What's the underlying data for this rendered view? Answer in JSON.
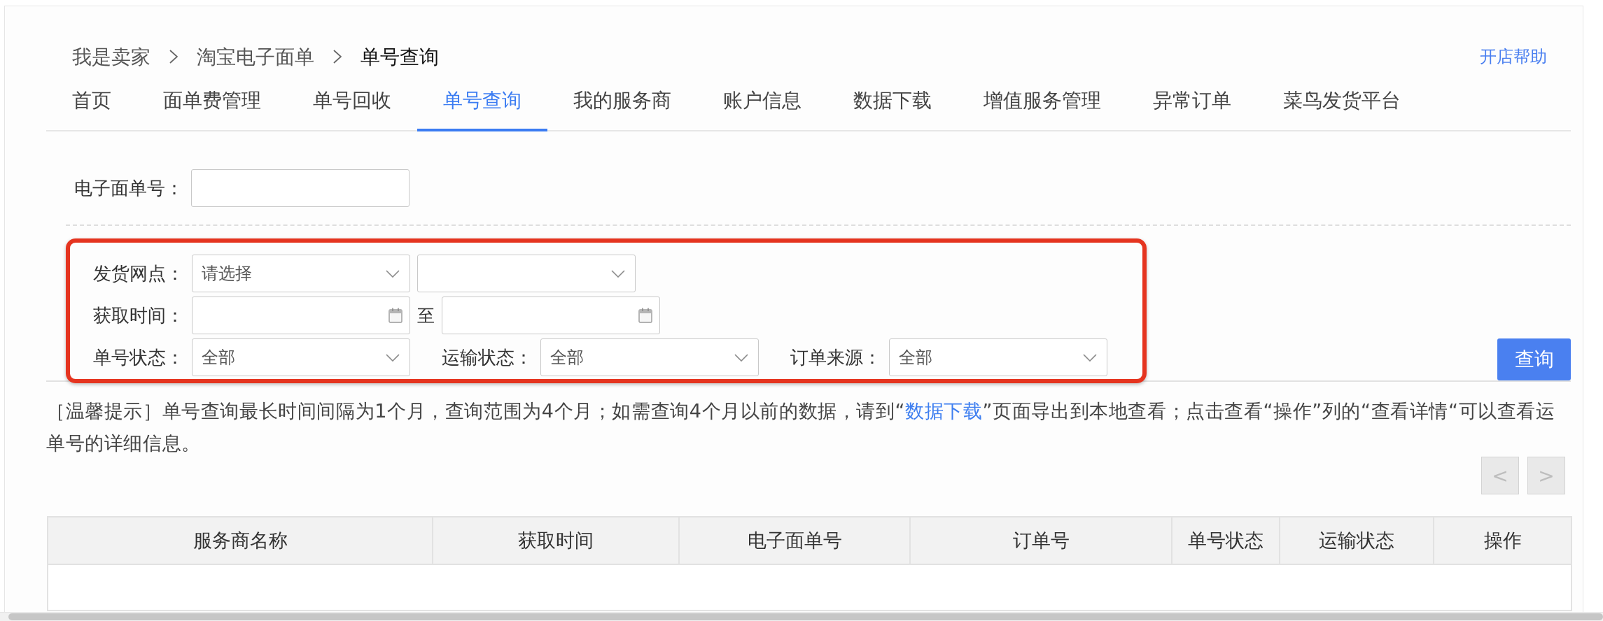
{
  "breadcrumb": [
    {
      "label": "我是卖家",
      "current": false
    },
    {
      "label": "淘宝电子面单",
      "current": false
    },
    {
      "label": "单号查询",
      "current": true
    }
  ],
  "help_link": "开店帮助",
  "tabs": [
    {
      "label": "首页",
      "selected": false
    },
    {
      "label": "面单费管理",
      "selected": false
    },
    {
      "label": "单号回收",
      "selected": false
    },
    {
      "label": "单号查询",
      "selected": true
    },
    {
      "label": "我的服务商",
      "selected": false
    },
    {
      "label": "账户信息",
      "selected": false
    },
    {
      "label": "数据下载",
      "selected": false
    },
    {
      "label": "增值服务管理",
      "selected": false
    },
    {
      "label": "异常订单",
      "selected": false
    },
    {
      "label": "菜鸟发货平台",
      "selected": false
    }
  ],
  "waybill_search": {
    "label": "电子面单号："
  },
  "filter_rows": [
    {
      "groups": [
        {
          "label": "发货网点：",
          "controls": [
            {
              "kind": "select",
              "value": "请选择"
            },
            {
              "kind": "select"
            }
          ]
        }
      ]
    },
    {
      "groups": [
        {
          "label": "获取时间：",
          "controls": [
            {
              "kind": "date"
            },
            {
              "kind": "separator",
              "text": "至"
            },
            {
              "kind": "date"
            }
          ]
        }
      ]
    },
    {
      "groups": [
        {
          "label": "单号状态：",
          "controls": [
            {
              "kind": "select",
              "value": "全部"
            }
          ]
        },
        {
          "label": "运输状态：",
          "controls": [
            {
              "kind": "select",
              "value": "全部"
            }
          ]
        },
        {
          "label": "订单来源：",
          "controls": [
            {
              "kind": "select",
              "value": "全部"
            }
          ]
        }
      ]
    }
  ],
  "query_button": "查询",
  "notice": {
    "before": "［温馨提示］单号查询最长时间间隔为1个月，查询范围为4个月；如需查询4个月以前的数据，请到“",
    "link": "数据下载",
    "after": "”页面导出到本地查看；点击查看“操作”列的“查看详情“可以查看运单号的详细信息。"
  },
  "pagination": [
    {
      "label": "<",
      "disabled": true
    },
    {
      "label": ">",
      "disabled": true
    }
  ],
  "table": {
    "columns": [
      "服务商名称",
      "获取时间",
      "电子面单号",
      "订单号",
      "单号状态",
      "运输状态",
      "操作"
    ]
  }
}
